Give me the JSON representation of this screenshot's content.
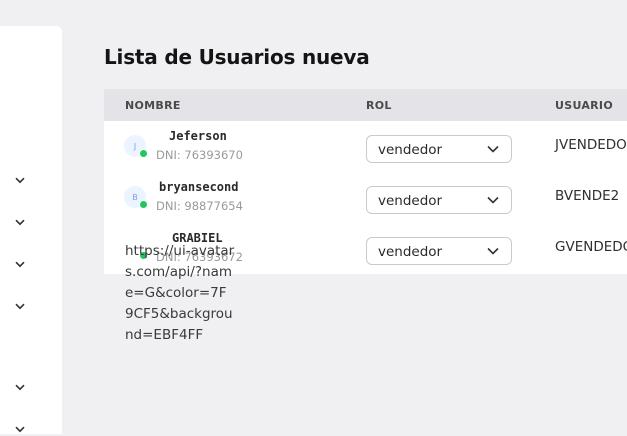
{
  "page": {
    "title": "Lista de Usuarios nueva"
  },
  "sidebar": {
    "chevrons": [
      {
        "icon": "chevron-down-icon"
      },
      {
        "icon": "chevron-down-icon"
      },
      {
        "icon": "chevron-down-icon"
      },
      {
        "icon": "chevron-down-icon"
      },
      {
        "icon": "chevron-down-icon"
      },
      {
        "icon": "chevron-down-icon"
      }
    ]
  },
  "table": {
    "headers": {
      "nombre": "NOMBRE",
      "rol": "ROL",
      "usuario": "USUARIO"
    },
    "rows": [
      {
        "avatar_initial": "J",
        "name": "Jeferson",
        "dni": "DNI: 76393670",
        "rol": "vendedor",
        "usuario": "JVENDEDOR"
      },
      {
        "avatar_initial": "B",
        "name": "bryansecond",
        "dni": "DNI: 98877654",
        "rol": "vendedor",
        "usuario": "BVENDE2"
      },
      {
        "avatar_initial": "",
        "name": "GRABIEL",
        "dni": "DNI: 76393672",
        "rol": "vendedor",
        "usuario": "GVENDEDOR"
      }
    ],
    "broken_avatar_alt": "https://ui-avatars.com/api/?name=G&color=7F9CF5&background=EBF4FF"
  },
  "colors": {
    "online": "#22c55e",
    "avatar_fg": "#7f9cf5",
    "avatar_bg": "#ebf4ff",
    "header_bg": "#e4e4e8"
  }
}
